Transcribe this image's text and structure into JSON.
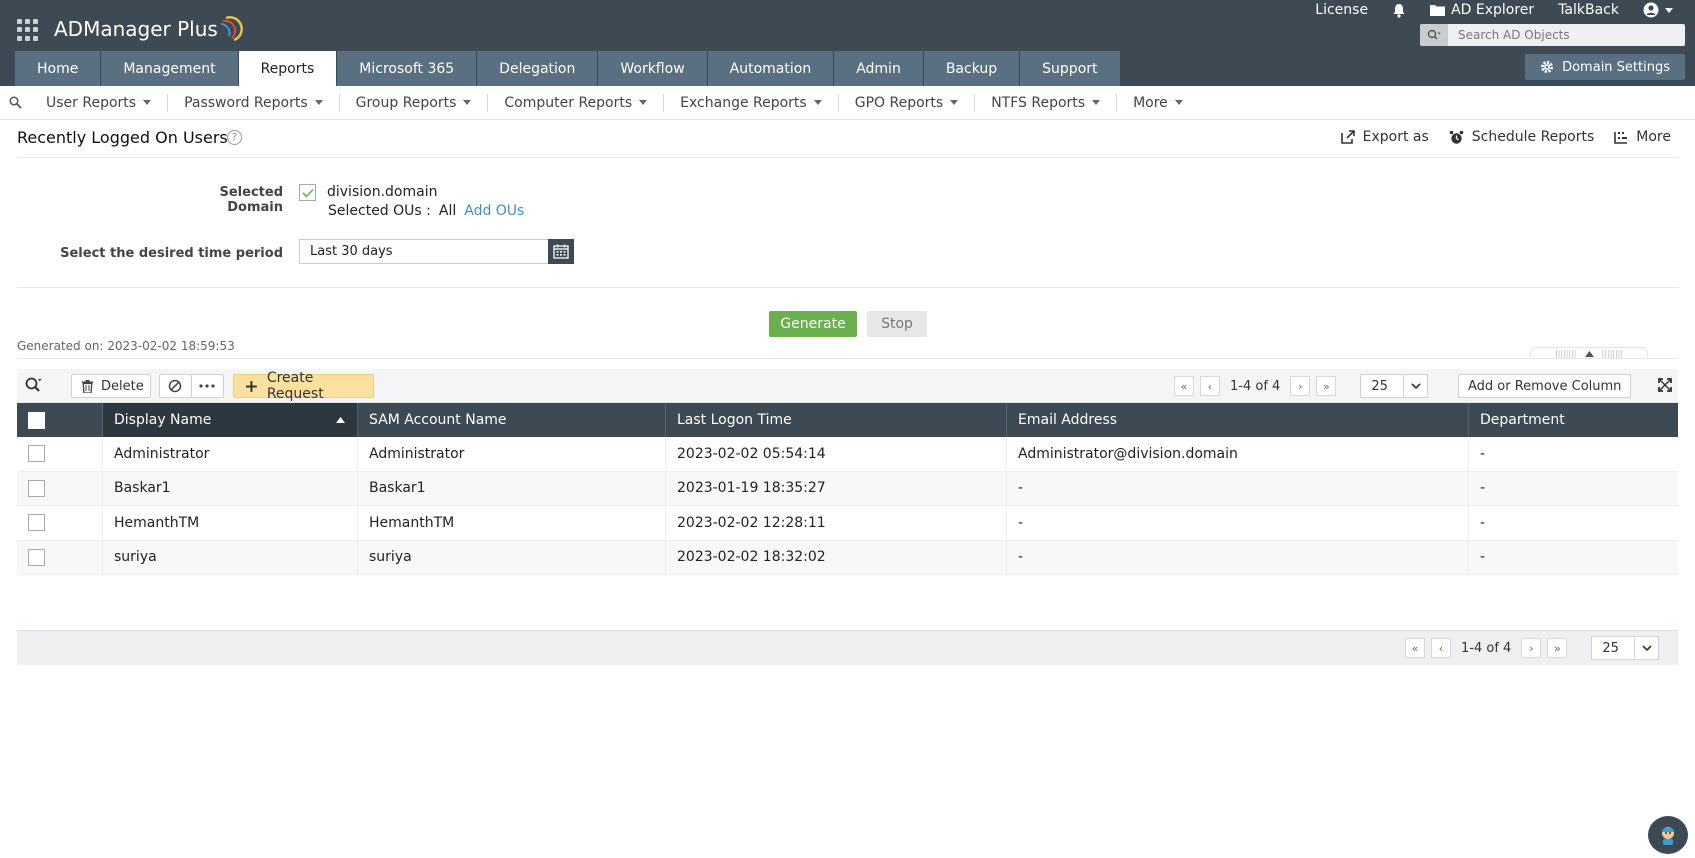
{
  "app": {
    "logo_text": "ADManager Plus"
  },
  "top_links": {
    "license": "License",
    "ad_explorer": "AD Explorer",
    "talkback": "TalkBack"
  },
  "search": {
    "placeholder": "Search AD Objects"
  },
  "main_tabs": [
    {
      "label": "Home"
    },
    {
      "label": "Management"
    },
    {
      "label": "Reports"
    },
    {
      "label": "Microsoft 365"
    },
    {
      "label": "Delegation"
    },
    {
      "label": "Workflow"
    },
    {
      "label": "Automation"
    },
    {
      "label": "Admin"
    },
    {
      "label": "Backup"
    },
    {
      "label": "Support"
    }
  ],
  "active_tab": "Reports",
  "domain_settings_label": "Domain Settings",
  "subnav": [
    {
      "label": "User Reports"
    },
    {
      "label": "Password Reports"
    },
    {
      "label": "Group Reports"
    },
    {
      "label": "Computer Reports"
    },
    {
      "label": "Exchange Reports"
    },
    {
      "label": "GPO Reports"
    },
    {
      "label": "NTFS Reports"
    },
    {
      "label": "More"
    }
  ],
  "page": {
    "title": "Recently Logged On Users",
    "help": "?",
    "actions": {
      "export": "Export as",
      "schedule": "Schedule Reports",
      "more": "More"
    }
  },
  "form": {
    "selected_domain_label": "Selected Domain",
    "domain_name": "division.domain",
    "selected_ous_label": "Selected OUs :",
    "selected_ous_value": "All",
    "add_ous_link": "Add OUs",
    "period_label": "Select the desired time period",
    "period_value": "Last 30 days",
    "generate_label": "Generate",
    "stop_label": "Stop",
    "generated_on": "Generated on: 2023-02-02 18:59:53"
  },
  "toolbar": {
    "delete_label": "Delete",
    "create_request_label": "Create Request",
    "pager_text": "1-4 of 4",
    "page_size": "25",
    "add_remove_column_label": "Add or Remove Column"
  },
  "table": {
    "columns": [
      "Display Name",
      "SAM Account Name",
      "Last Logon Time",
      "Email Address",
      "Department"
    ],
    "rows": [
      {
        "display_name": "Administrator",
        "sam": "Administrator",
        "logon": "2023-02-02 05:54:14",
        "email": "Administrator@division.domain",
        "dept": "-"
      },
      {
        "display_name": "Baskar1",
        "sam": "Baskar1",
        "logon": "2023-01-19 18:35:27",
        "email": "-",
        "dept": "-"
      },
      {
        "display_name": "HemanthTM",
        "sam": "HemanthTM",
        "logon": "2023-02-02 12:28:11",
        "email": "-",
        "dept": "-"
      },
      {
        "display_name": "suriya",
        "sam": "suriya",
        "logon": "2023-02-02 18:32:02",
        "email": "-",
        "dept": "-"
      }
    ]
  },
  "footer": {
    "pager_text": "1-4 of 4",
    "page_size": "25"
  },
  "colors": {
    "header_bg": "#3d4a53",
    "tab_bg": "#5a6f80",
    "generate_green": "#6ab04c",
    "create_request_yellow": "#fbe0a0",
    "link_blue": "#3f8fcf"
  }
}
